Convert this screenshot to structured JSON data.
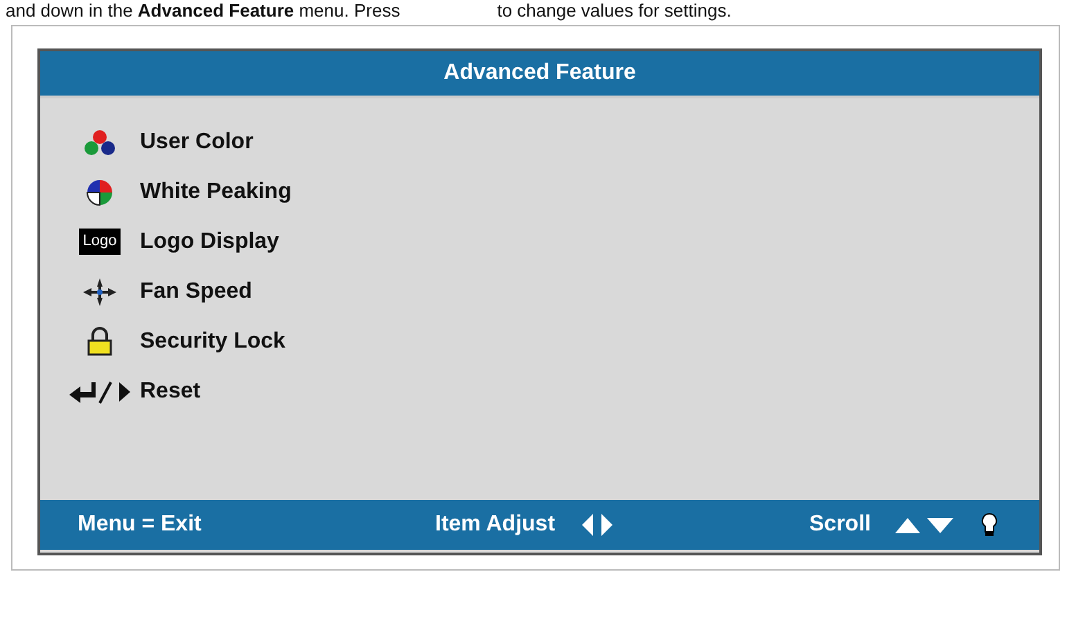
{
  "manual_text": {
    "before": "and down in the **Advanced Feature** menu. Press",
    "after": "to change values for settings."
  },
  "menu": {
    "title": "Advanced Feature",
    "items": [
      {
        "label": "User Color"
      },
      {
        "label": "White Peaking"
      },
      {
        "label": "Logo Display",
        "icon_text": "Logo"
      },
      {
        "label": "Fan Speed"
      },
      {
        "label": "Security Lock"
      },
      {
        "label": "Reset"
      }
    ]
  },
  "footer": {
    "exit": "Menu = Exit",
    "adjust": "Item Adjust",
    "scroll": "Scroll"
  }
}
